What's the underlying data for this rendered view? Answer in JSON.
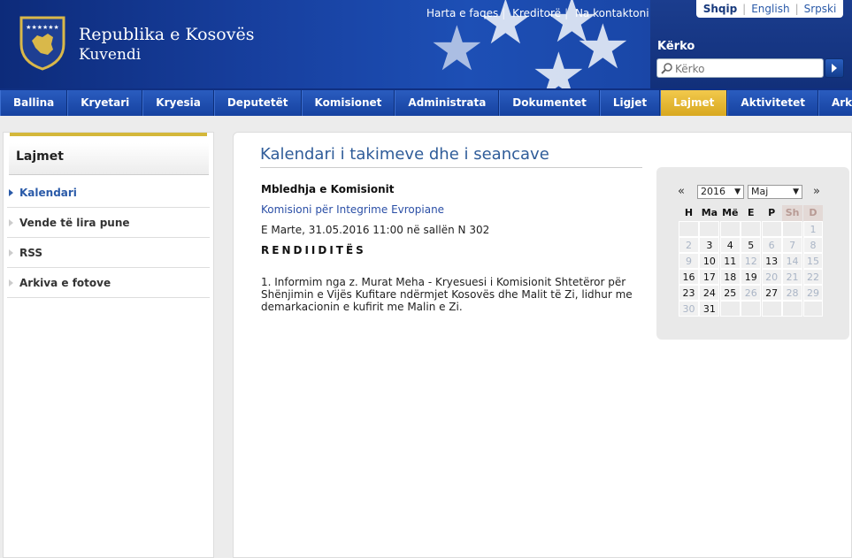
{
  "header": {
    "title_line1": "Republika e Kosovës",
    "title_line2": "Kuvendi",
    "top_links": [
      "Harta e faqes",
      "Kreditorë",
      "Na kontaktoni"
    ],
    "languages": [
      "Shqip",
      "English",
      "Srpski"
    ],
    "active_language": "Shqip",
    "search_label": "Kërko",
    "search_placeholder": "Kërko",
    "colors": {
      "nav_blue": "#1d4fb5",
      "active_tab": "#e6b838",
      "title_blue": "#2f5c99"
    }
  },
  "nav": {
    "items": [
      "Ballina",
      "Kryetari",
      "Kryesia",
      "Deputetët",
      "Komisionet",
      "Administrata",
      "Dokumentet",
      "Ligjet",
      "Lajmet",
      "Aktivitetet",
      "Arkivi"
    ],
    "active": "Lajmet"
  },
  "sidebar": {
    "title": "Lajmet",
    "items": [
      "Kalendari",
      "Vende të lira pune",
      "RSS",
      "Arkiva e fotove"
    ],
    "active": "Kalendari"
  },
  "main": {
    "title": "Kalendari i takimeve dhe i seancave",
    "meeting_type": "Mbledhja e Komisionit",
    "commission": "Komisioni për Integrime Evropiane",
    "datetime": "E Marte, 31.05.2016 11:00 në sallën N 302",
    "agenda_title": "RENDIIDITËS",
    "agenda_item": "1. Informim nga z. Murat Meha - Kryesuesi i Komisionit Shtetëror për Shënjimin e Vijës Kufitare ndërmjet Kosovës dhe Malit të Zi, lidhur me demarkacionin e kufirit me Malin e Zi."
  },
  "calendar": {
    "prev": "«",
    "next": "»",
    "year": "2016",
    "month": "Maj",
    "weekdays": [
      "H",
      "Ma",
      "Më",
      "E",
      "P",
      "Sh",
      "D"
    ],
    "weeks": [
      [
        "",
        "",
        "",
        "",
        "",
        "",
        "1"
      ],
      [
        "2",
        "3",
        "4",
        "5",
        "6",
        "7",
        "8"
      ],
      [
        "9",
        "10",
        "11",
        "12",
        "13",
        "14",
        "15"
      ],
      [
        "16",
        "17",
        "18",
        "19",
        "20",
        "21",
        "22"
      ],
      [
        "23",
        "24",
        "25",
        "26",
        "27",
        "28",
        "29"
      ],
      [
        "30",
        "31",
        "",
        "",
        "",
        "",
        ""
      ]
    ],
    "dim_days": [
      "2",
      "6",
      "9",
      "12",
      "20",
      "26",
      "30"
    ]
  }
}
